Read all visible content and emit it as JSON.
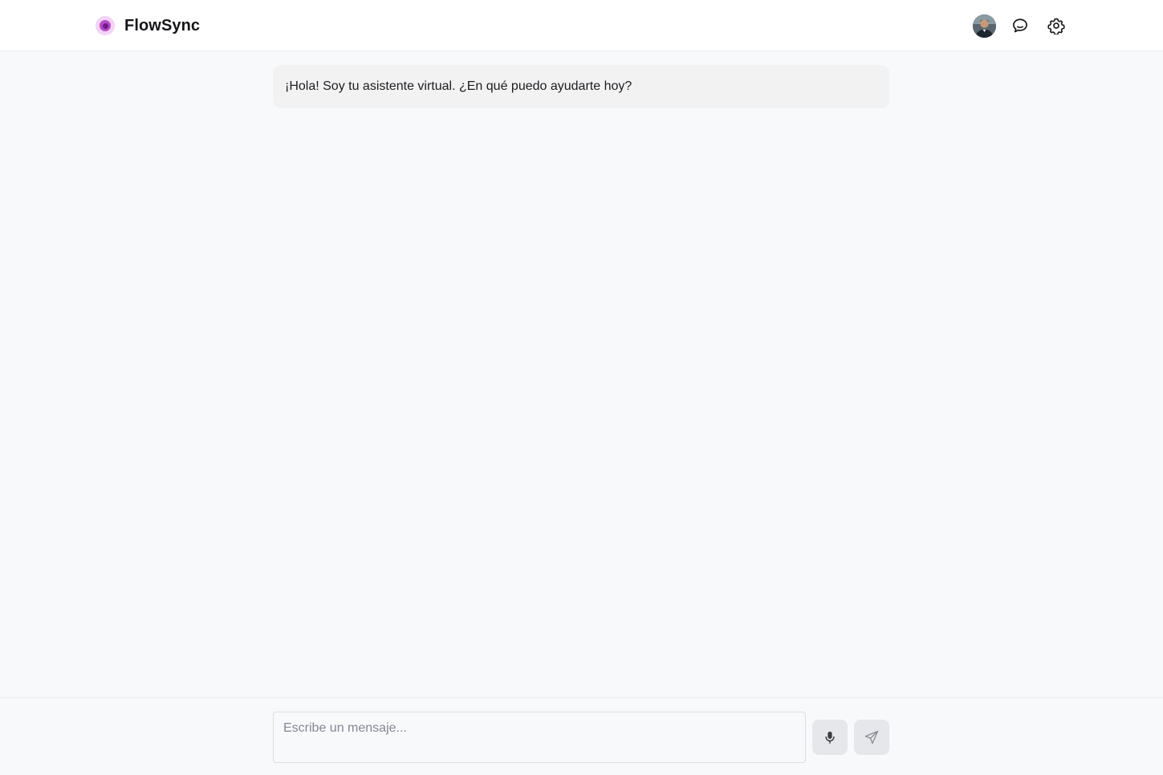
{
  "header": {
    "brand_name": "FlowSync",
    "brand_colors": {
      "outer": "#f3d3f6",
      "middle": "#b64bc8",
      "core": "#6c1a86"
    },
    "actions": [
      {
        "name": "user-avatar",
        "icon": "avatar"
      },
      {
        "name": "chat",
        "icon": "chat-bubble-icon"
      },
      {
        "name": "settings",
        "icon": "gear-icon"
      }
    ]
  },
  "chat": {
    "messages": [
      {
        "role": "assistant",
        "text": "¡Hola! Soy tu asistente virtual. ¿En qué puedo ayudarte hoy?"
      }
    ]
  },
  "composer": {
    "placeholder": "Escribe un mensaje...",
    "value": "",
    "mic_icon": "microphone-icon",
    "send_icon": "send-icon"
  }
}
